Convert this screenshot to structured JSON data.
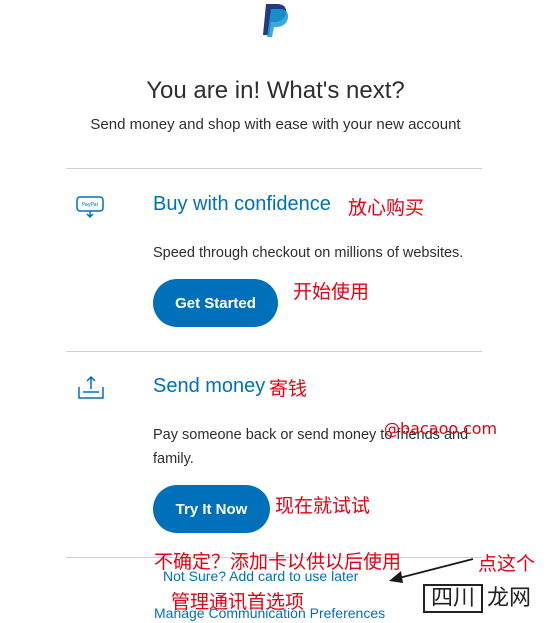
{
  "header": {
    "headline": "You are in! What's next?",
    "subheadline": "Send money and shop with ease with your new account",
    "logo_icon": "paypal-logo-icon"
  },
  "sections": [
    {
      "icon": "paypal-card-icon",
      "title": "Buy with confidence",
      "annotation": "放心购买",
      "description": "Speed through checkout on millions of websites.",
      "button": "Get Started",
      "button_annotation": "开始使用"
    },
    {
      "icon": "upload-tray-icon",
      "title": "Send money",
      "annotation": "寄钱",
      "description": "Pay someone back or send money to friends and family.",
      "button": "Try It Now",
      "button_annotation": "现在就试试"
    }
  ],
  "watermark_site": "@bacaoo.com",
  "footer": {
    "not_sure_annotation": "不确定？添加卡以供以后使用",
    "click_this_annotation": "点这个",
    "not_sure_link": "Not Sure? Add card to use later",
    "prefs_annotation": "管理通讯首选项",
    "prefs_link": "Manage Communication Preferences"
  },
  "watermark": {
    "boxed": "四川",
    "rest": "龙网"
  },
  "colors": {
    "brand_blue": "#0070ba",
    "annotation_red": "#e60012",
    "paypal_dark": "#253b80",
    "paypal_light": "#179bd7"
  }
}
